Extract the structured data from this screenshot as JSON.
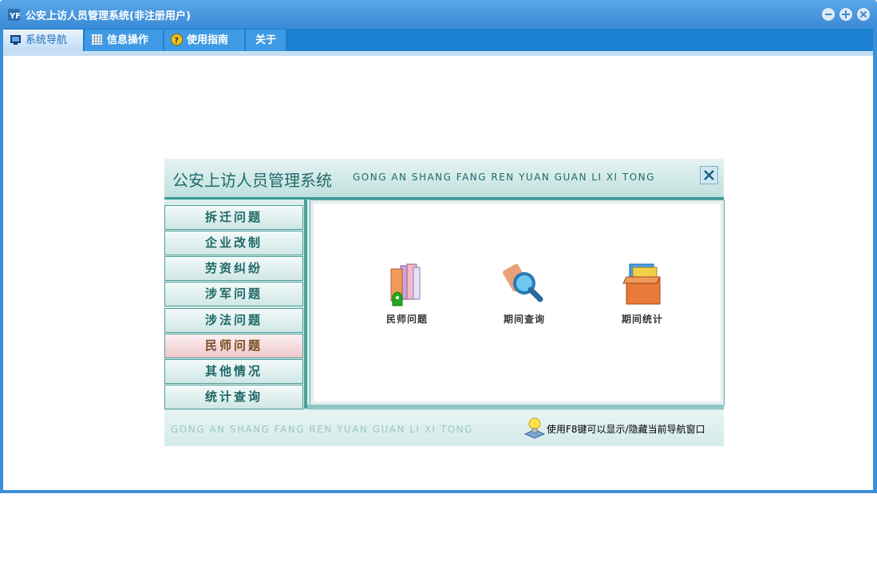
{
  "window": {
    "title": "公安上访人员管理系统(非注册用户)",
    "accent": "#3b8fd7"
  },
  "tabs": [
    {
      "label": "系统导航",
      "icon": "monitor-icon",
      "active": true
    },
    {
      "label": "信息操作",
      "icon": "grid-icon",
      "active": false
    },
    {
      "label": "使用指南",
      "icon": "help-icon",
      "active": false
    },
    {
      "label": "关于",
      "icon": "",
      "active": false
    }
  ],
  "panel": {
    "title": "公安上访人员管理系统",
    "pinyin": "GONG AN SHANG FANG REN YUAN GUAN LI XI TONG",
    "menu": [
      {
        "label": "拆迁问题"
      },
      {
        "label": "企业改制"
      },
      {
        "label": "劳资纠纷"
      },
      {
        "label": "涉军问题"
      },
      {
        "label": "涉法问题"
      },
      {
        "label": "民师问题",
        "active": true
      },
      {
        "label": "其他情况"
      },
      {
        "label": "统计查询"
      }
    ],
    "features": [
      {
        "label": "民师问题",
        "icon": "books-icon"
      },
      {
        "label": "期间查询",
        "icon": "magnifier-icon"
      },
      {
        "label": "期间统计",
        "icon": "folder-box-icon"
      }
    ],
    "footer": {
      "pinyin": "GONG AN SHANG FANG REN YUAN GUAN LI XI TONG",
      "hint": "使用F8键可以显示/隐藏当前导航窗口",
      "hint_icon": "lightbulb-icon"
    }
  }
}
